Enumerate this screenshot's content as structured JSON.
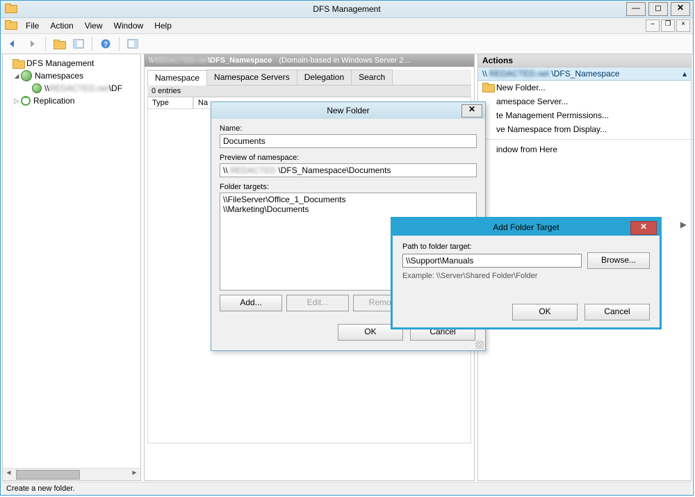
{
  "app": {
    "title": "DFS Management"
  },
  "menu": {
    "file": "File",
    "action": "Action",
    "view": "View",
    "window": "Window",
    "help": "Help"
  },
  "tree": {
    "root": "DFS Management",
    "namespaces": "Namespaces",
    "namespace_item_prefix": "\\\\",
    "namespace_item_suffix": "\\DF",
    "replication": "Replication"
  },
  "main": {
    "header_prefix": "\\\\",
    "header_mid": "\\DFS_Namespace",
    "header_desc": "(Domain-based in Windows Server 2...",
    "tabs": {
      "namespace": "Namespace",
      "servers": "Namespace Servers",
      "delegation": "Delegation",
      "search": "Search"
    },
    "entries": "0 entries",
    "col_type": "Type",
    "col_name": "Na"
  },
  "actions": {
    "header": "Actions",
    "context_prefix": "\\\\",
    "context_suffix": "\\DFS_Namespace",
    "new_folder": "New Folder...",
    "add_ns_server": "amespace Server...",
    "delegate_perm": "te Management Permissions...",
    "remove_display": "ve Namespace from Display...",
    "window_from_here": "indow from Here"
  },
  "new_folder_dialog": {
    "title": "New Folder",
    "name_label": "Name:",
    "name_value": "Documents",
    "preview_label": "Preview of namespace:",
    "preview_prefix": "\\\\",
    "preview_suffix": "\\DFS_Namespace\\Documents",
    "targets_label": "Folder targets:",
    "target1": "\\\\FileServer\\Office_1_Documents",
    "target2": "\\\\Marketing\\Documents",
    "btn_add": "Add...",
    "btn_edit": "Edit...",
    "btn_remove": "Remove",
    "btn_ok": "OK",
    "btn_cancel": "Cancel"
  },
  "add_target_dialog": {
    "title": "Add Folder Target",
    "path_label": "Path to folder target:",
    "path_value": "\\\\Support\\Manuals",
    "browse": "Browse...",
    "example": "Example: \\\\Server\\Shared Folder\\Folder",
    "ok": "OK",
    "cancel": "Cancel"
  },
  "status": "Create a new folder."
}
